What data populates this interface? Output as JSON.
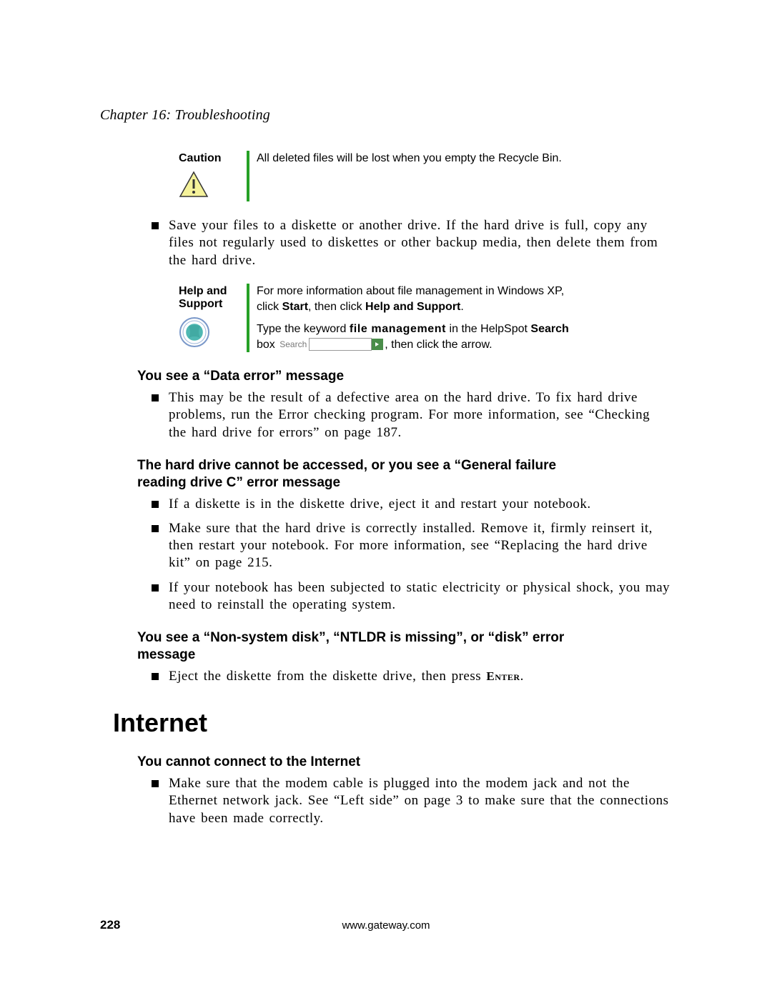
{
  "chapter": "Chapter 16: Troubleshooting",
  "caution": {
    "label": "Caution",
    "text": "All deleted files will be lost when you empty the Recycle Bin."
  },
  "bullet_save": "Save your files to a diskette or another drive. If the hard drive is full, copy any files not regularly used to diskettes or other backup media, then delete them from the hard drive.",
  "help": {
    "label_l1": "Help and",
    "label_l2": "Support",
    "line1_a": "For more information about file management in Windows XP, click ",
    "line1_b": "Start",
    "line1_c": ", then click ",
    "line1_d": "Help and Support",
    "line1_e": ".",
    "line2_a": "Type the keyword ",
    "line2_kw": "file management",
    "line2_b": " in the HelpSpot ",
    "line2_c": "Search",
    "line2_d": " box ",
    "search_label": "Search",
    "line2_e": ", then click the arrow."
  },
  "sub_data_error": "You see a “Data error” message",
  "bullet_data_error": "This may be the result of a defective area on the hard drive. To fix hard drive problems, run the Error checking program. For more information, see “Checking the hard drive for errors” on page 187.",
  "sub_general_failure": "The hard drive cannot be accessed, or you see a “General failure reading drive C” error message",
  "bullet_gf_1": "If a diskette is in the diskette drive, eject it and restart your notebook.",
  "bullet_gf_2": "Make sure that the hard drive is correctly installed. Remove it, firmly reinsert it, then restart your notebook. For more information, see “Replacing the hard drive kit” on page 215.",
  "bullet_gf_3": "If your notebook has been subjected to static electricity or physical shock, you may need to reinstall the operating system.",
  "sub_ntldr": "You see a “Non-system disk”, “NTLDR is missing”, or “disk” error message",
  "bullet_ntldr_a": "Eject the diskette from the diskette drive, then press ",
  "bullet_ntldr_b": "Enter",
  "bullet_ntldr_c": ".",
  "section_internet": "Internet",
  "sub_cannot_connect": "You cannot connect to the Internet",
  "bullet_internet": "Make sure that the modem cable is plugged into the modem jack and not the Ethernet network jack. See “Left side” on page 3 to make sure that the connections have been made correctly.",
  "footer": {
    "page": "228",
    "url": "www.gateway.com"
  }
}
